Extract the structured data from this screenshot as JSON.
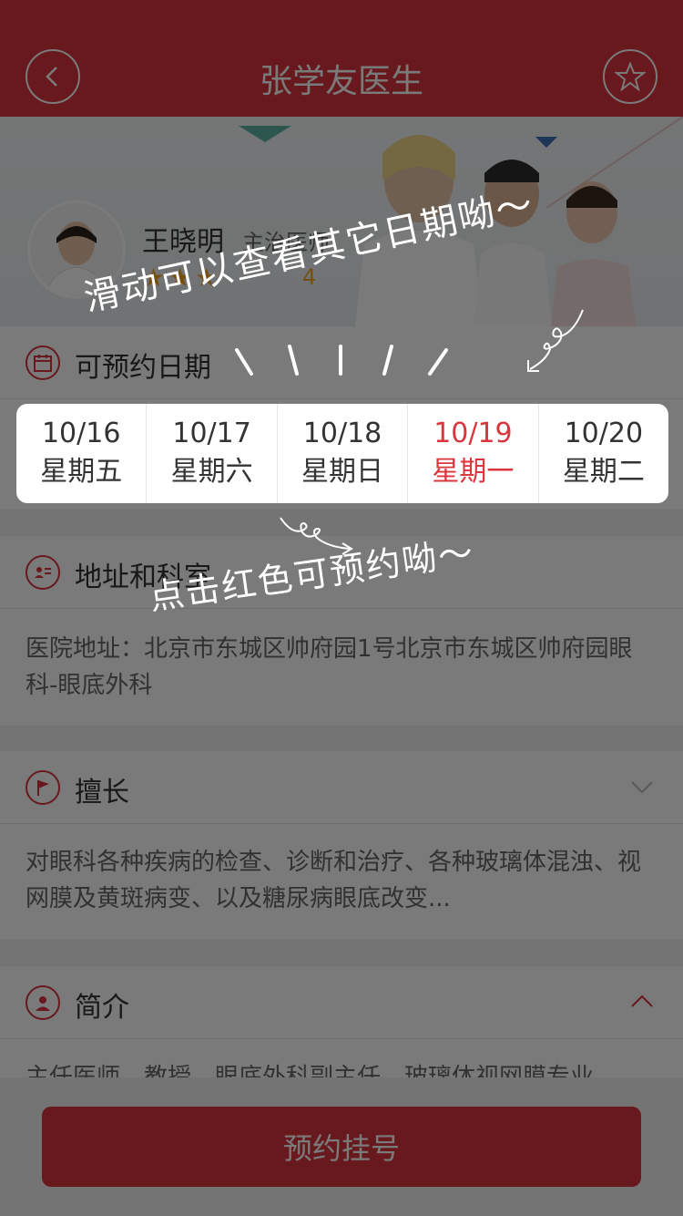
{
  "header": {
    "title": "张学友医生",
    "back_icon": "back-arrow-icon",
    "favorite_icon": "star-outline-icon"
  },
  "doctor": {
    "name": "王晓明",
    "title": "主治医师",
    "stars": "★★★",
    "rating": "4"
  },
  "schedule": {
    "section_title": "可预约日期",
    "dates": [
      {
        "date": "10/16",
        "day": "星期五"
      },
      {
        "date": "10/17",
        "day": "星期六"
      },
      {
        "date": "10/18",
        "day": "星期日"
      },
      {
        "date": "10/19",
        "day": "星期一",
        "available": true
      },
      {
        "date": "10/20",
        "day": "星期二"
      }
    ]
  },
  "address": {
    "section_title": "地址和科室",
    "text": "医院地址：北京市东城区帅府园1号北京市东城区帅府园眼科-眼底外科"
  },
  "specialty": {
    "section_title": "擅长",
    "text": "对眼科各种疾病的检查、诊断和治疗、各种玻璃体混浊、视网膜及黄斑病变、以及糖尿病眼底改变..."
  },
  "intro": {
    "section_title": "简介",
    "text": "主任医师，教授，眼底外科副主任，玻璃体视网膜专业"
  },
  "bottom": {
    "book_label": "预约挂号"
  },
  "guide": {
    "swipe_hint": "滑动可以查看其它日期呦～",
    "tap_hint": "点击红色可预约呦～"
  },
  "colors": {
    "primary": "#d9363e",
    "star": "#f6a623"
  }
}
